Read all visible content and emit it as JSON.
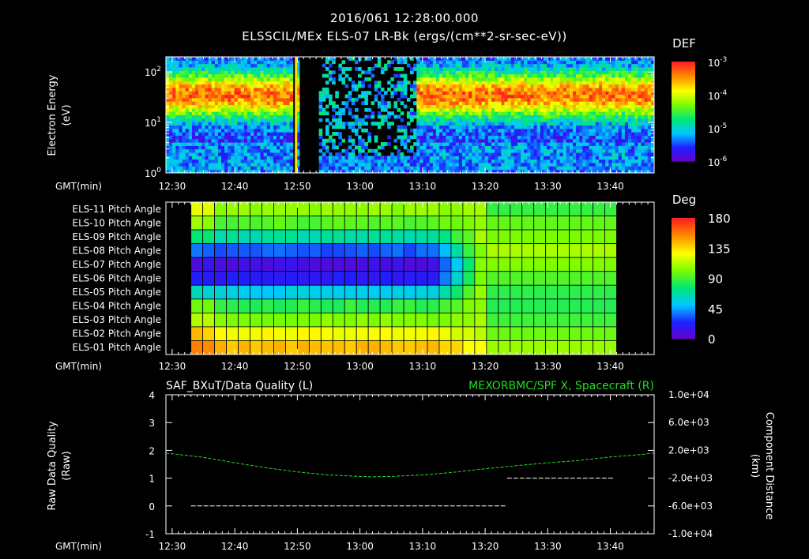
{
  "header": {
    "timestamp": "2016/061 12:28:00.000",
    "title": "ELSSCIL/MEx ELS-07 LR-Bk  (ergs/(cm**2-sr-sec-eV))"
  },
  "colors": {
    "background": "#000000",
    "foreground": "#ffffff",
    "green_series": "#22dd22",
    "colorbar": [
      "#6a00c8",
      "#1f1fff",
      "#00c8ff",
      "#00e676",
      "#7cfc00",
      "#ffff00",
      "#ff8c00",
      "#ff2020"
    ]
  },
  "time_axis": {
    "label": "GMT(min)",
    "ticks": [
      "12:30",
      "12:40",
      "12:50",
      "13:00",
      "13:10",
      "13:20",
      "13:30",
      "13:40"
    ],
    "tick_minutes": [
      750,
      760,
      770,
      780,
      790,
      800,
      810,
      820
    ],
    "range_minutes": [
      749,
      827
    ]
  },
  "chart_data": [
    {
      "type": "heatmap",
      "name": "energy-spectrogram",
      "ylabel": "Electron Energy (eV)",
      "y_scale": "log",
      "ylim": [
        1,
        200
      ],
      "y_ticks": [
        "10^2",
        "10^1",
        "10^0"
      ],
      "colorbar": {
        "title": "DEF",
        "ticks": [
          "10^-3",
          "10^-4",
          "10^-5",
          "10^-6"
        ],
        "range": [
          1e-06,
          0.001
        ],
        "scale": "log"
      },
      "gaps_minutes": [
        [
          769.2,
          769.8
        ],
        [
          770.2,
          773.3
        ]
      ],
      "data_gap_band_minutes": [
        770.2,
        789.0
      ]
    },
    {
      "type": "heatmap",
      "name": "pitch-angle",
      "rows": [
        "ELS-11 Pitch Angle",
        "ELS-10 Pitch Angle",
        "ELS-09 Pitch Angle",
        "ELS-08 Pitch Angle",
        "ELS-07 Pitch Angle",
        "ELS-06 Pitch Angle",
        "ELS-05 Pitch Angle",
        "ELS-04 Pitch Angle",
        "ELS-03 Pitch Angle",
        "ELS-02 Pitch Angle",
        "ELS-01 Pitch Angle"
      ],
      "data_range_minutes": [
        753,
        821
      ],
      "colorbar": {
        "title": "Deg",
        "ticks": [
          "180",
          "135",
          "90",
          "45",
          "0"
        ],
        "range": [
          0,
          180
        ]
      },
      "grid": true
    },
    {
      "type": "line",
      "name": "data-quality-and-spacecraft-x",
      "title_left": "SAF_BXuT/Data Quality (L)",
      "title_right": "MEXORBMC/SPF X, Spacecraft (R)",
      "ylabel_left": "Raw Data Quality (Raw)",
      "ylabel_right": "Component Distance (km)",
      "ylim_left": [
        -1,
        4
      ],
      "left_ticks": [
        "4",
        "3",
        "2",
        "1",
        "0",
        "-1"
      ],
      "ylim_right": [
        -10000,
        10000
      ],
      "right_ticks": [
        "1.0e+04",
        "6.0e+03",
        "2.0e+03",
        "-2.0e+03",
        "-6.0e+03",
        "-1.0e+04"
      ],
      "series": [
        {
          "segments": [
            {
              "x": [
                753,
                803.5
              ],
              "y": [
                0,
                0
              ]
            },
            {
              "x": [
                803.5,
                820.5
              ],
              "y": [
                1,
                1
              ]
            }
          ]
        },
        {
          "x": [
            749,
            755,
            760,
            765,
            770,
            775,
            780,
            782,
            785,
            790,
            795,
            800,
            805,
            810,
            815,
            820,
            825,
            827
          ],
          "y": [
            1600,
            1000,
            200,
            -500,
            -1100,
            -1550,
            -1750,
            -1800,
            -1750,
            -1550,
            -1150,
            -650,
            -200,
            200,
            550,
            1050,
            1400,
            1650
          ]
        }
      ]
    }
  ]
}
